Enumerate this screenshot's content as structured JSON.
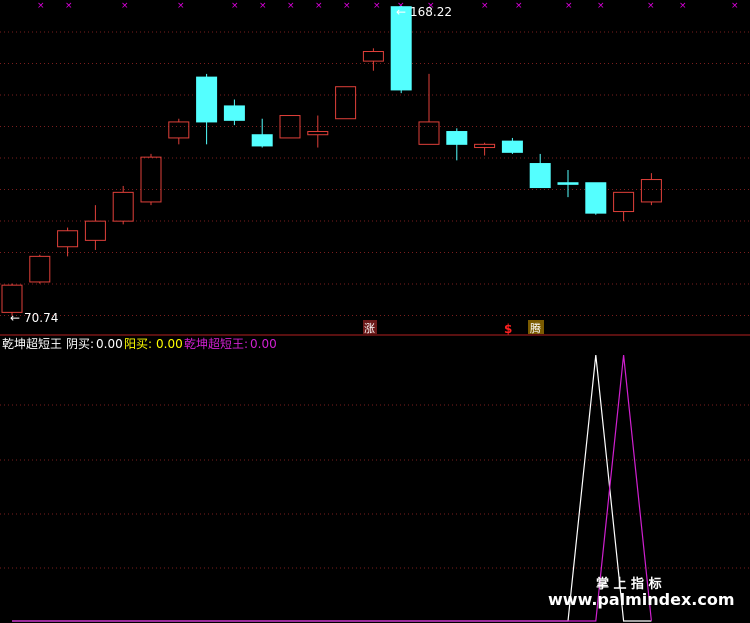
{
  "colors": {
    "background": "#000000",
    "up_candle": "#e0403a",
    "down_candle": "#54ffff",
    "grid": "#7a1e1e",
    "separator": "#b32020",
    "marker_x": "#e000e0",
    "indicator_white": "#ffffff",
    "indicator_magenta": "#d020d0",
    "label_white": "#ffffff",
    "label_yellow": "#ffff00",
    "label_magenta": "#d020d0"
  },
  "main_panel": {
    "high_label": "168.22",
    "low_label": "70.74",
    "marker_zhang": "涨",
    "marker_dollar": "$",
    "marker_teng": "腾"
  },
  "indicator_panel": {
    "name": "乾坤超短王",
    "yin_label": "阴买:",
    "yin_value": "0.00",
    "yang_label": "阳买:",
    "yang_value": "0.00",
    "qk_label": "乾坤超短王:",
    "qk_value": "0.00"
  },
  "watermark": {
    "title": "掌 上 指 标",
    "url": "www.palmindex.com"
  },
  "chart_data": [
    {
      "type": "candlestick",
      "title": "",
      "ylim": [
        70.74,
        168.22
      ],
      "candles": [
        {
          "o": 72.5,
          "c": 81.0,
          "h": 81.5,
          "l": 71.5,
          "up": true
        },
        {
          "o": 82.0,
          "c": 90.0,
          "h": 90.5,
          "l": 81.5,
          "up": true
        },
        {
          "o": 93.0,
          "c": 98.0,
          "h": 99.0,
          "l": 90.0,
          "up": true
        },
        {
          "o": 95.0,
          "c": 101.0,
          "h": 106.0,
          "l": 92.0,
          "up": true
        },
        {
          "o": 101.0,
          "c": 110.0,
          "h": 112.0,
          "l": 100.0,
          "up": true
        },
        {
          "o": 107.0,
          "c": 121.0,
          "h": 122.0,
          "l": 106.0,
          "up": true
        },
        {
          "o": 127.0,
          "c": 132.0,
          "h": 133.0,
          "l": 125.0,
          "up": true
        },
        {
          "o": 146.0,
          "c": 132.0,
          "h": 147.0,
          "l": 125.0,
          "down": true
        },
        {
          "o": 137.0,
          "c": 132.5,
          "h": 139.0,
          "l": 131.0,
          "down": true
        },
        {
          "o": 128.0,
          "c": 124.5,
          "h": 133.0,
          "l": 124.0,
          "down": true
        },
        {
          "o": 127.0,
          "c": 134.0,
          "h": 134.0,
          "l": 127.0,
          "up": true
        },
        {
          "o": 128.0,
          "c": 129.0,
          "h": 134.0,
          "l": 124.0,
          "up": true
        },
        {
          "o": 133.0,
          "c": 143.0,
          "h": 143.0,
          "l": 133.0,
          "up": true
        },
        {
          "o": 151.0,
          "c": 154.0,
          "h": 155.0,
          "l": 148.0,
          "up": true
        },
        {
          "o": 168.0,
          "c": 142.0,
          "h": 168.22,
          "l": 141.0,
          "down": true
        },
        {
          "o": 125.0,
          "c": 132.0,
          "h": 147.0,
          "l": 125.0,
          "up": true
        },
        {
          "o": 129.0,
          "c": 125.0,
          "h": 130.0,
          "l": 120.0,
          "down": true
        },
        {
          "o": 124.0,
          "c": 125.0,
          "h": 125.5,
          "l": 121.5,
          "up": true
        },
        {
          "o": 126.0,
          "c": 122.5,
          "h": 127.0,
          "l": 122.0,
          "down": true
        },
        {
          "o": 119.0,
          "c": 111.5,
          "h": 122.0,
          "l": 111.5,
          "down": true
        },
        {
          "o": 113.0,
          "c": 112.5,
          "h": 117.0,
          "l": 108.5,
          "down": true
        },
        {
          "o": 113.0,
          "c": 103.5,
          "h": 113.0,
          "l": 103.0,
          "down": true
        },
        {
          "o": 104.0,
          "c": 110.0,
          "h": 110.0,
          "l": 101.0,
          "up": true
        },
        {
          "o": 107.0,
          "c": 114.0,
          "h": 116.0,
          "l": 106.0,
          "up": true
        }
      ]
    },
    {
      "type": "line",
      "title": "",
      "ylim": [
        0,
        1
      ],
      "series": [
        {
          "name": "阴买",
          "color": "#ffffff",
          "values": [
            0,
            0,
            0,
            0,
            0,
            0,
            0,
            0,
            0,
            0,
            0,
            0,
            0,
            0,
            0,
            0,
            0,
            0,
            0,
            0,
            0,
            1,
            0,
            0
          ]
        },
        {
          "name": "乾坤超短王",
          "color": "#d020d0",
          "values": [
            0,
            0,
            0,
            0,
            0,
            0,
            0,
            0,
            0,
            0,
            0,
            0,
            0,
            0,
            0,
            0,
            0,
            0,
            0,
            0,
            0,
            0,
            1,
            0
          ]
        }
      ]
    }
  ]
}
